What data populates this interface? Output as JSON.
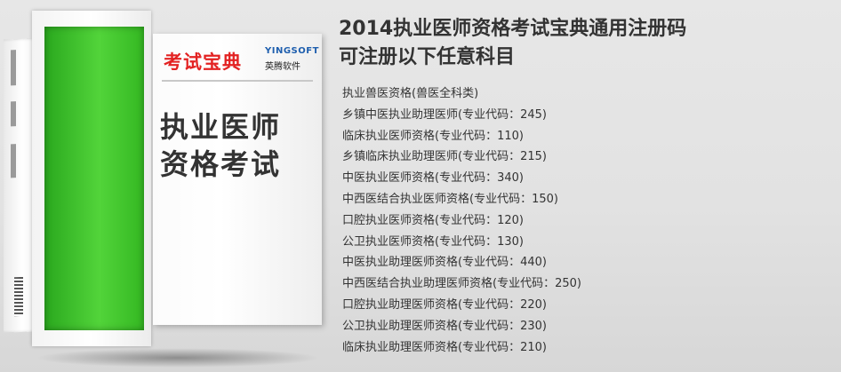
{
  "product_box": {
    "title": "考试宝典",
    "brand_en": "YINGSOFT",
    "brand_cn": "英腾软件",
    "subject_line1": "执业医师",
    "subject_line2": "资格考试",
    "colors": {
      "green": "#3cc428",
      "red": "#e32222"
    }
  },
  "heading": {
    "line1": "2014执业医师资格考试宝典通用注册码",
    "line2": "可注册以下任意科目"
  },
  "subjects": [
    "执业兽医资格(兽医全科类)",
    "乡镇中医执业助理医师(专业代码：245)",
    "临床执业医师资格(专业代码：110)",
    "乡镇临床执业助理医师(专业代码：215)",
    "中医执业医师资格(专业代码：340)",
    "中西医结合执业医师资格(专业代码：150)",
    "口腔执业医师资格(专业代码：120)",
    "公卫执业医师资格(专业代码：130)",
    "中医执业助理医师资格(专业代码：440)",
    "中西医结合执业助理医师资格(专业代码：250)",
    "口腔执业助理医师资格(专业代码：220)",
    "公卫执业助理医师资格(专业代码：230)",
    "临床执业助理医师资格(专业代码：210)"
  ]
}
